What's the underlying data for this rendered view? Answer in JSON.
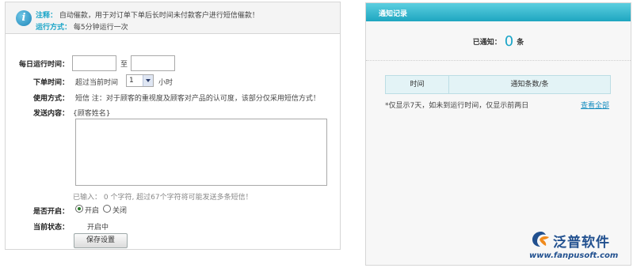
{
  "notice": {
    "note_key": "注释：",
    "note_text": "自动催款，用于对订单下单后长时间未付款客户进行短信催款！",
    "run_key": "运行方式：",
    "run_text": "每5分钟运行一次",
    "icon": "info-icon"
  },
  "form": {
    "daily_time_label": "每日运行时间：",
    "to_text": "至",
    "order_time_label": "下单时间：",
    "order_time_prefix": "超过当前时间",
    "hours_value": "1",
    "hours_unit": "小时",
    "method_label": "使用方式：",
    "method_text": "短信  注：对于顾客的重视度及顾客对产品的认可度，该部分仅采用短信方式！",
    "content_label": "发送内容：",
    "content_tag": "{顾客姓名}",
    "input_hint": "已输入： 0 个字符, 超过67个字符将可能发送多条短信！",
    "enable_label": "是否开启：",
    "on_label": "开启",
    "off_label": "关闭",
    "status_label": "当前状态：",
    "status_value": "开启中",
    "save_button": "保存设置"
  },
  "log": {
    "title": "通知记录",
    "notified_label": "已通知：",
    "notified_count": "0",
    "notified_unit": "条",
    "col_time": "时间",
    "col_count": "通知条数/条",
    "tip": "*仅显示7天，如未到运行时间，仅显示前两日",
    "view_all": "查看全部"
  },
  "logo": {
    "name": "泛普软件",
    "url": "www.fanpusoft.com"
  },
  "colors": {
    "accent": "#1aa5c8",
    "header_gradient_top": "#5ccfe0",
    "header_gradient_bottom": "#1ea6c0",
    "logo_blue": "#21508f",
    "logo_orange": "#f08a1c"
  }
}
